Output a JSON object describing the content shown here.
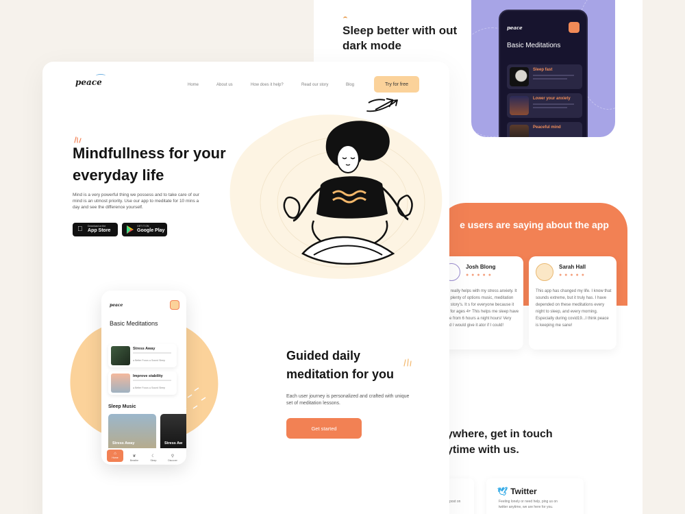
{
  "back": {
    "sleep_title": "Sleep better with out dark mode",
    "dark_phone": {
      "logo": "peace",
      "title": "Basic Meditations",
      "cards": [
        {
          "title": "Sleep fast"
        },
        {
          "title": "Lower your anxiety"
        },
        {
          "title": "Peaceful mind"
        }
      ]
    },
    "testimonials": {
      "title": "e users are saying about the app",
      "items": [
        {
          "name": "Josh Blong",
          "stars": "● ● ● ● ●",
          "text": "app really helps with my stress anxiety. It has plenty of options music, meditation and story's. It s for everyone because it has for ages 4+ This helps me sleep have gone from 6 hours a night hours! Very good I would give it ator if I could!"
        },
        {
          "name": "Sarah Hall",
          "stars": "● ● ● ● ●",
          "text": "This app has changed my life. I know that sounds extreme, but it truly has. I have depended on these meditations every night to sleep, and every morning. Especially during covid19...I think peace is keeping me sane!"
        }
      ]
    },
    "contact_title": "ywhere, get in touch ytime with us.",
    "contact_cards": [
      {
        "heading": "",
        "text": "post on"
      },
      {
        "heading": "Twitter",
        "text": "Feeling lonely or need help, ping us on twitter anytime, we are here for you."
      }
    ]
  },
  "main": {
    "logo": "peace",
    "nav": [
      "Home",
      "About us",
      "How does it help?",
      "Read our story",
      "Blog"
    ],
    "cta": "Try for free",
    "hero_title": "Mindfullness for your everyday life",
    "hero_desc": "Mind is a very powerful thing we possess and to take care of our mind is an utmost priority. Use our app to meditate for 10 mins a day and see the difference yourself.",
    "stores": [
      {
        "small": "Download on the",
        "big": "App Store",
        "icon": "apple-icon"
      },
      {
        "small": "GET IT ON",
        "big": "Google Play",
        "icon": "play-icon"
      }
    ],
    "guided_title": "Guided daily meditation for you",
    "guided_desc": "Each user journey is personalized and crafted with unique set of meditation lessons.",
    "get_started": "Get started",
    "phone": {
      "logo": "peace",
      "title": "Basic Meditations",
      "cards": [
        {
          "title": "Stress Away",
          "tags": "● Better Focus   ● Sound Sleep"
        },
        {
          "title": "Improve stability",
          "tags": "● Better Focus   ● Sound Sleep"
        }
      ],
      "sleep_music": "Sleep Music",
      "music": [
        {
          "title": "Stress Away"
        },
        {
          "title": "Stress Aw"
        }
      ],
      "tabs": [
        {
          "label": "Home",
          "icon": "home-icon"
        },
        {
          "label": "Breathe",
          "icon": "leaf-icon"
        },
        {
          "label": "Sleep",
          "icon": "moon-icon"
        },
        {
          "label": "Discover",
          "icon": "search-icon"
        }
      ]
    }
  },
  "colors": {
    "accent": "#f28154",
    "cta_bg": "#fbd29a",
    "lavender": "#a7a4e6",
    "dark": "#17142e"
  }
}
